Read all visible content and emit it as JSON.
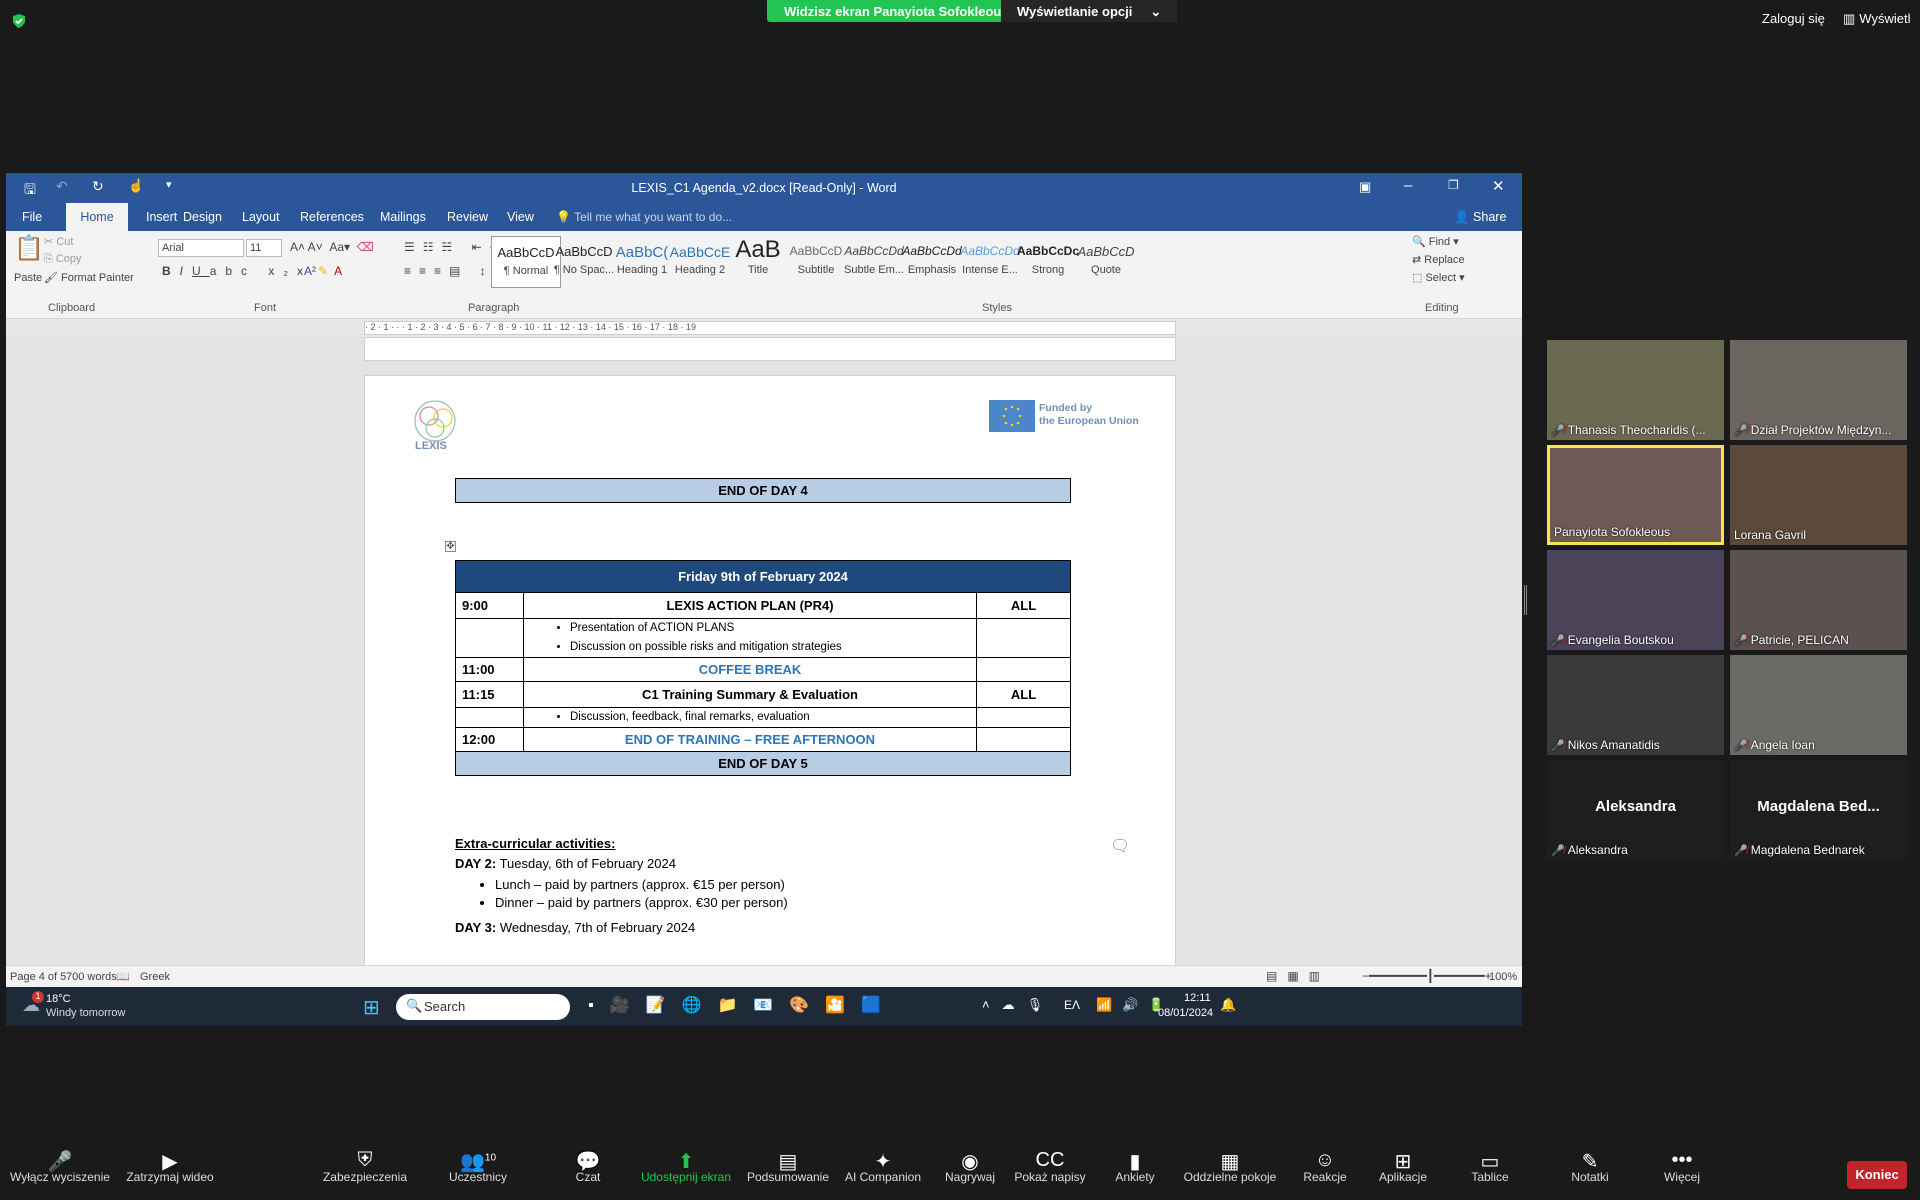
{
  "zoom_top": {
    "share_banner": "Widzisz ekran Panayiota Sofokleous",
    "view_options": "Wyświetlanie opcji",
    "login": "Zaloguj się",
    "view": "Wyświetl"
  },
  "word": {
    "title": "LEXIS_C1 Agenda_v2.docx [Read-Only] - Word",
    "tabs": [
      "File",
      "Home",
      "Insert",
      "Design",
      "Layout",
      "References",
      "Mailings",
      "Review",
      "View"
    ],
    "tell_me": "Tell me what you want to do...",
    "share": "Share",
    "clipboard": {
      "paste": "Paste",
      "cut": "Cut",
      "copy": "Copy",
      "format_painter": "Format Painter",
      "label": "Clipboard"
    },
    "font": {
      "name": "Arial",
      "size": "11",
      "label": "Font"
    },
    "paragraph_label": "Paragraph",
    "styles": [
      {
        "preview": "AaBbCcD",
        "name": "¶ Normal"
      },
      {
        "preview": "AaBbCcD",
        "name": "¶ No Spac..."
      },
      {
        "preview": "AaBbC(",
        "name": "Heading 1"
      },
      {
        "preview": "AaBbCcE",
        "name": "Heading 2"
      },
      {
        "preview": "AaB",
        "name": "Title"
      },
      {
        "preview": "AaBbCcD",
        "name": "Subtitle"
      },
      {
        "preview": "AaBbCcDd",
        "name": "Subtle Em..."
      },
      {
        "preview": "AaBbCcDd",
        "name": "Emphasis"
      },
      {
        "preview": "AaBbCcDd",
        "name": "Intense E..."
      },
      {
        "preview": "AaBbCcDc",
        "name": "Strong"
      },
      {
        "preview": "AaBbCcD",
        "name": "Quote"
      }
    ],
    "styles_label": "Styles",
    "editing": {
      "find": "Find",
      "replace": "Replace",
      "select": "Select",
      "label": "Editing"
    },
    "ruler": "· 2 · 1 · · · 1 · 2 · 3 · 4 · 5 · 6 · 7 · 8 · 9 · 10 · 11 · 12 · 13 · 14 · 15 · 16 · 17 · 18 · 19",
    "funded": [
      "Funded by",
      "the European Union"
    ],
    "logo_text": "LEXIS",
    "end_day4": "END OF DAY 4",
    "friday_header": "Friday 9th of February 2024",
    "agenda_rows": [
      {
        "time": "9:00",
        "title": "LEXIS ACTION PLAN (PR4)",
        "who": "ALL"
      },
      {
        "bullets": [
          "Presentation of ACTION PLANS",
          "Discussion on possible risks and mitigation strategies"
        ]
      },
      {
        "time": "11:00",
        "title": "COFFEE BREAK",
        "accent": true
      },
      {
        "time": "11:15",
        "title": "C1 Training Summary & Evaluation",
        "who": "ALL"
      },
      {
        "bullets": [
          "Discussion, feedback, final remarks, evaluation"
        ]
      },
      {
        "time": "12:00",
        "title": "END OF TRAINING – FREE AFTERNOON",
        "accent": true
      }
    ],
    "end_day5": "END OF DAY 5",
    "extra_heading": "Extra-curricular activities:",
    "day2_label": "DAY 2:",
    "day2_text": "Tuesday, 6th of February 2024",
    "day2_items": [
      "Lunch – paid by partners (approx. €15 per person)",
      "Dinner – paid by partners (approx. €30 per person)"
    ],
    "day3_label": "DAY 3:",
    "day3_text": "Wednesday, 7th of February 2024",
    "status": {
      "page": "Page 4 of 5",
      "words": "700 words",
      "lang": "Greek",
      "zoom": "100%"
    }
  },
  "taskbar": {
    "weather_temp": "18°C",
    "weather_desc": "Windy tomorrow",
    "search": "Search",
    "time": "12:11",
    "date": "08/01/2024",
    "lang": "ΕΛ",
    "badge": "1"
  },
  "participants": [
    {
      "name": "Thanasis Theocharidis (...",
      "muted": true
    },
    {
      "name": "Dział Projektów Międzyn...",
      "muted": true
    },
    {
      "name": "Panayiota Sofokleous",
      "muted": false,
      "active": true
    },
    {
      "name": "Lorana Gavril",
      "muted": false
    },
    {
      "name": "Evangelia Boutskou",
      "muted": true
    },
    {
      "name": "Patricie, PELICAN",
      "muted": true
    },
    {
      "name": "Nikos Amanatidis",
      "muted": true
    },
    {
      "name": "Angela Ioan",
      "muted": true
    },
    {
      "name": "Aleksandra",
      "muted": true,
      "big": "Aleksandra"
    },
    {
      "name": "Magdalena Bednarek",
      "muted": true,
      "big": "Magdalena  Bed..."
    }
  ],
  "controls": [
    {
      "label": "Wyłącz wyciszenie",
      "icon": "🎤"
    },
    {
      "label": "Zatrzymaj wideo",
      "icon": "▶"
    },
    {
      "label": "Zabezpieczenia",
      "icon": "⛨"
    },
    {
      "label": "Uczestnicy",
      "icon": "👥",
      "count": "10"
    },
    {
      "label": "Czat",
      "icon": "💬"
    },
    {
      "label": "Udostępnij ekran",
      "icon": "⬆"
    },
    {
      "label": "Podsumowanie",
      "icon": "▤"
    },
    {
      "label": "AI Companion",
      "icon": "✦"
    },
    {
      "label": "Nagrywaj",
      "icon": "◉"
    },
    {
      "label": "Pokaż napisy",
      "icon": "CC"
    },
    {
      "label": "Ankiety",
      "icon": "▮"
    },
    {
      "label": "Oddzielne pokoje",
      "icon": "▦"
    },
    {
      "label": "Reakcje",
      "icon": "☺"
    },
    {
      "label": "Aplikacje",
      "icon": "⊞"
    },
    {
      "label": "Tablice",
      "icon": "▭"
    },
    {
      "label": "Notatki",
      "icon": "✎"
    },
    {
      "label": "Więcej",
      "icon": "•••"
    }
  ],
  "end_button": "Koniec"
}
